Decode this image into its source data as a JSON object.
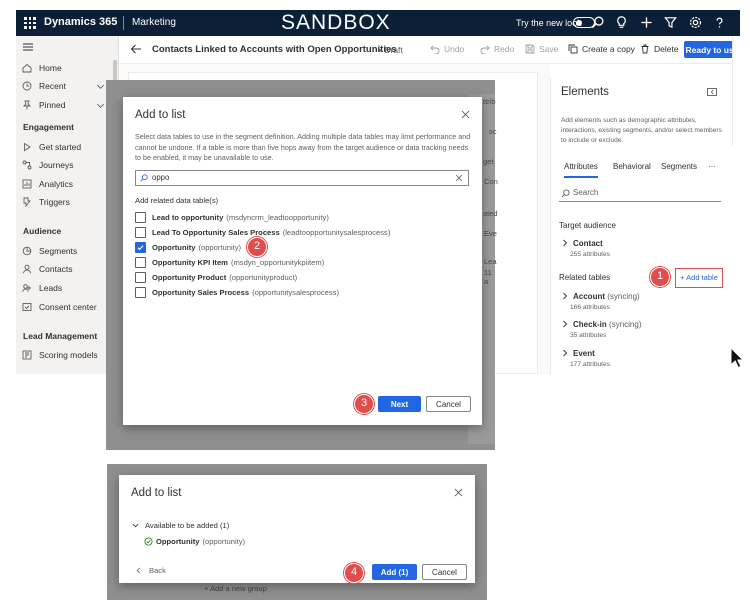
{
  "topbar": {
    "brand": "Dynamics 365",
    "app": "Marketing",
    "environment": "SANDBOX",
    "try_new_look": "Try the new look",
    "icons": [
      "waffle-icon",
      "search-icon",
      "lightbulb-icon",
      "plus-icon",
      "filter-icon",
      "gear-icon",
      "help-icon"
    ]
  },
  "nav": {
    "items_top": [
      {
        "label": "Home",
        "icon": "home-icon"
      },
      {
        "label": "Recent",
        "icon": "clock-icon"
      },
      {
        "label": "Pinned",
        "icon": "pin-icon"
      }
    ],
    "sections": [
      {
        "title": "Engagement",
        "items": [
          {
            "label": "Get started",
            "icon": "play-icon"
          },
          {
            "label": "Journeys",
            "icon": "journey-icon"
          },
          {
            "label": "Analytics",
            "icon": "analytics-icon"
          },
          {
            "label": "Triggers",
            "icon": "trigger-icon"
          }
        ]
      },
      {
        "title": "Audience",
        "items": [
          {
            "label": "Segments",
            "icon": "segments-icon"
          },
          {
            "label": "Contacts",
            "icon": "person-icon"
          },
          {
            "label": "Leads",
            "icon": "leads-icon"
          },
          {
            "label": "Consent center",
            "icon": "consent-icon"
          }
        ]
      },
      {
        "title": "Lead Management",
        "items": [
          {
            "label": "Scoring models",
            "icon": "scoring-icon"
          }
        ]
      }
    ]
  },
  "command_bar": {
    "title": "Contacts Linked to Accounts with Open Opportunities",
    "status": "Draft",
    "undo": "Undo",
    "redo": "Redo",
    "save": "Save",
    "copy": "Create a copy",
    "delete": "Delete",
    "ready": "Ready to use"
  },
  "elements_panel": {
    "title": "Elements",
    "description": "Add elements such as demographic attributes, interactions, existing segments, and/or select members to include or exclude.",
    "tabs": [
      "Attributes",
      "Behavioral",
      "Segments",
      "···"
    ],
    "active_tab": "Attributes",
    "search_placeholder": "Search",
    "target_audience_label": "Target audience",
    "target": {
      "name": "Contact",
      "attributes": "255 attributes"
    },
    "related_label": "Related tables",
    "add_table": "+ Add table",
    "related": [
      {
        "name": "Account",
        "status": "(syncing)",
        "attributes": "166 attributes"
      },
      {
        "name": "Check-in",
        "status": "(syncing)",
        "attributes": "35 attributes"
      },
      {
        "name": "Event",
        "status": "",
        "attributes": "177 attributes"
      }
    ]
  },
  "background_fragments": [
    "ttrib",
    "sc",
    "get",
    "Con",
    "ated",
    "Eve",
    "Lea",
    "11 a"
  ],
  "dialog1": {
    "title": "Add to list",
    "description": "Select data tables to use in the segment definition. Adding multiple data tables may limit performance and cannot be undone. If a table is more than five hops away from the target audience or data tracking needs to be enabled, it may be unavailable to use.",
    "search_value": "oppo",
    "subheading": "Add related data table(s)",
    "options": [
      {
        "name": "Lead to opportunity",
        "logical": "(msdyncrm_leadtoopportunity)",
        "checked": false
      },
      {
        "name": "Lead To Opportunity Sales Process",
        "logical": "(leadtoopportunitysalesprocess)",
        "checked": false
      },
      {
        "name": "Opportunity",
        "logical": "(opportunity)",
        "checked": true
      },
      {
        "name": "Opportunity KPI Item",
        "logical": "(msdyn_opportunitykpiitem)",
        "checked": false
      },
      {
        "name": "Opportunity Product",
        "logical": "(opportunityproduct)",
        "checked": false
      },
      {
        "name": "Opportunity Sales Process",
        "logical": "(opportunitysalesprocess)",
        "checked": false
      }
    ],
    "next": "Next",
    "cancel": "Cancel"
  },
  "dialog2": {
    "title": "Add to list",
    "available_label": "Available to be added (1)",
    "item": {
      "name": "Opportunity",
      "logical": "(opportunity)"
    },
    "back": "Back",
    "add": "Add (1)",
    "cancel": "Cancel",
    "ghost_text": "Add a new group"
  },
  "callouts": [
    "1",
    "2",
    "3",
    "4"
  ],
  "colors": {
    "topbar": "#0b1f36",
    "primary": "#2266e3",
    "callout": "#e34c4c",
    "check_green": "#107c10"
  }
}
